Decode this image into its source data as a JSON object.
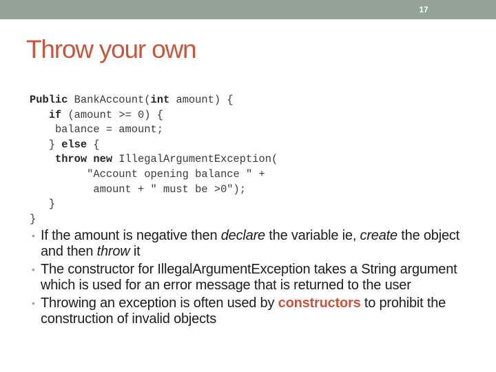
{
  "slide": {
    "number": "17",
    "title": "Throw your own",
    "accent_color": "#c8553d",
    "header_bar_color": "#93a397"
  },
  "code": {
    "lines": [
      [
        {
          "t": "Public",
          "b": true
        },
        {
          "t": " BankAccount("
        },
        {
          "t": "int",
          "b": true
        },
        {
          "t": " amount) {"
        }
      ],
      [
        {
          "t": "   "
        },
        {
          "t": "if",
          "b": true
        },
        {
          "t": " (amount >= 0) {"
        }
      ],
      [
        {
          "t": "    balance = amount;"
        }
      ],
      [
        {
          "t": "   } "
        },
        {
          "t": "else",
          "b": true
        },
        {
          "t": " {"
        }
      ],
      [
        {
          "t": "    "
        },
        {
          "t": "throw new",
          "b": true
        },
        {
          "t": " IllegalArgumentException("
        }
      ],
      [
        {
          "t": "         \"Account opening balance \" +"
        }
      ],
      [
        {
          "t": "          amount + \" must be >0\");"
        }
      ],
      [
        {
          "t": "   }"
        }
      ],
      [
        {
          "t": "}"
        }
      ]
    ]
  },
  "bullets": [
    {
      "segments": [
        {
          "t": "If the amount is negative then "
        },
        {
          "t": "declare",
          "style": "em"
        },
        {
          "t": " the variable ie, "
        },
        {
          "t": "create",
          "style": "em"
        },
        {
          "t": " the object and then "
        },
        {
          "t": "throw",
          "style": "em"
        },
        {
          "t": " it"
        }
      ]
    },
    {
      "segments": [
        {
          "t": "The constructor for IllegalArgumentException takes a String argument which is used for an error message that is returned to the user"
        }
      ]
    },
    {
      "segments": [
        {
          "t": "Throwing an exception is often used by "
        },
        {
          "t": "constructors",
          "style": "hl"
        },
        {
          "t": " to prohibit the construction of invalid objects"
        }
      ]
    }
  ]
}
